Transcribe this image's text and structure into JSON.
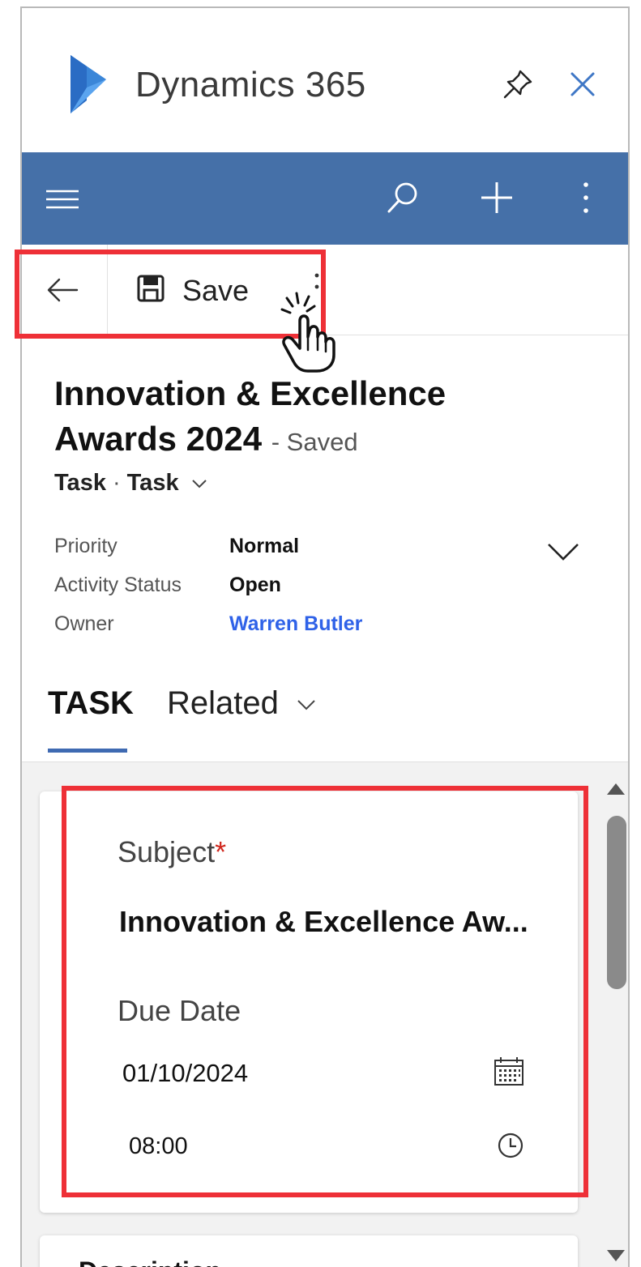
{
  "app": {
    "title": "Dynamics 365",
    "icons": {
      "logo": "dynamics-logo",
      "pin": "pin-icon",
      "close": "close-icon"
    }
  },
  "nav": {
    "icons": [
      "hamburger-menu-icon",
      "search-icon",
      "plus-icon",
      "more-vertical-icon"
    ],
    "bg_color": "#4570a8"
  },
  "command_bar": {
    "back_icon": "back-arrow-icon",
    "save_label": "Save",
    "save_icon": "save-disk-icon"
  },
  "record": {
    "title": "Innovation & Excellence Awards 2024",
    "status": "- Saved",
    "entity": "Task",
    "form": "Task",
    "fields": [
      {
        "label": "Priority",
        "value": "Normal"
      },
      {
        "label": "Activity Status",
        "value": "Open"
      },
      {
        "label": "Owner",
        "value": "Warren Butler"
      }
    ]
  },
  "tabs": [
    {
      "label": "TASK",
      "active": true
    },
    {
      "label": "Related",
      "active": false
    }
  ],
  "form": {
    "subject_label": "Subject",
    "required_mark": "*",
    "subject_value": "Innovation & Excellence Aw...",
    "due_date_label": "Due Date",
    "due_date": "01/10/2024",
    "due_time": "08:00",
    "next_section_label": "Description"
  },
  "colors": {
    "accent": "#4570a8",
    "highlight": "#ee3037",
    "link": "#2f62e8",
    "required": "#d0271d"
  }
}
